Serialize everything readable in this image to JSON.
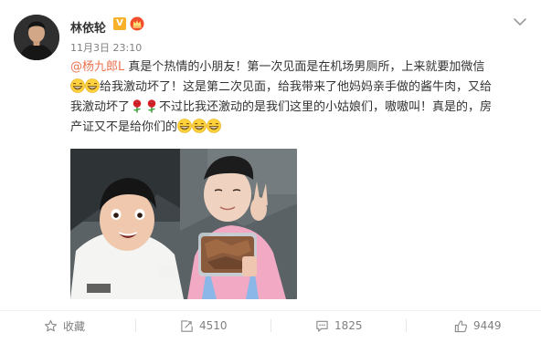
{
  "post": {
    "author": {
      "name": "林依轮",
      "verified_mark": "V"
    },
    "timestamp": "11月3日 23:10",
    "text": {
      "line1_mention": "@杨九郎L",
      "line1_rest": " 真是个热情的小朋友！第一次见面是在机场男厕所，上来就要加微信",
      "line2": "给我激动坏了！这是第二次见面，给我带来了他妈妈亲手做的酱牛肉，又给",
      "line3_a": "我激动坏了",
      "line3_b": "不过比我还激动的是我们这里的小姑娘们，嗷嗷叫！真是的，房",
      "line4": "产证又不是给你们的"
    },
    "emoji": {
      "grin": "grin-emoji",
      "rose": "rose-emoji"
    }
  },
  "actions": {
    "favorite_label": "收藏",
    "repost_count": "4510",
    "comment_count": "1825",
    "like_count": "9449"
  },
  "colors": {
    "mention": "#eb7350",
    "muted": "#808080",
    "verified": "#f7b12b"
  }
}
